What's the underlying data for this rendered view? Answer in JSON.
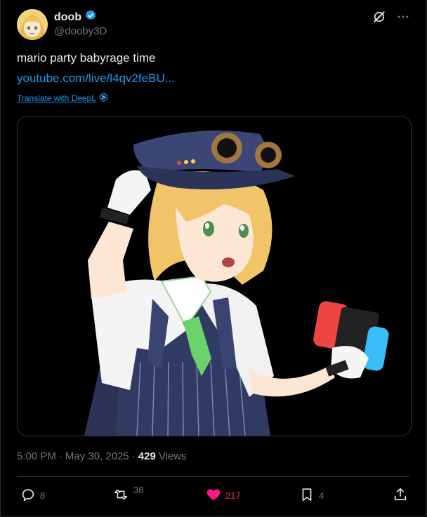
{
  "author": {
    "display_name": "doob",
    "handle": "@dooby3D",
    "verified": true
  },
  "tweet": {
    "text": "mario party babyrage time",
    "link": "youtube.com/live/l4qv2feBU...",
    "translate_label": "Translate with DeepL"
  },
  "meta": {
    "time": "5:00 PM",
    "sep1": "·",
    "date": "May 30, 2025",
    "sep2": "·",
    "views_count": "429",
    "views_label": "Views"
  },
  "actions": {
    "replies": "8",
    "reposts": "38",
    "likes": "217",
    "bookmarks": "4"
  },
  "colors": {
    "accent": "#1d9bf0",
    "like": "#f91880",
    "muted": "#71767b",
    "text": "#e7e9ea",
    "border": "#2f3336"
  }
}
